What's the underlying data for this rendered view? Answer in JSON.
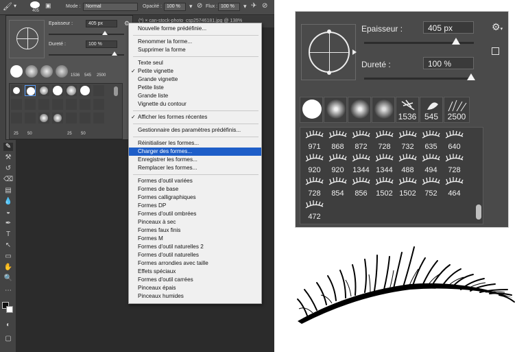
{
  "options_bar": {
    "brush_size": "405",
    "mode_label": "Mode :",
    "mode_value": "Normal",
    "opacity_label": "Opacité :",
    "opacity_value": "100 %",
    "flow_label": "Flux :",
    "flow_value": "100 %"
  },
  "document_tab": "(*) ×   can-stock-photo_csp25746181.jpg @ 138%",
  "small_brush_panel": {
    "size_label": "Epaisseur :",
    "size_value": "405 px",
    "hardness_label": "Dureté :",
    "hardness_value": "100 %",
    "tip_numbers": [
      "1536",
      "545",
      "2500"
    ],
    "grid_numbers": [
      "25",
      "50",
      "25",
      "50"
    ]
  },
  "menu": {
    "items": [
      {
        "label": "Nouvelle forme prédéfinie...",
        "checked": false,
        "highlighted": false
      },
      {
        "label": "Renommer la forme...",
        "checked": false,
        "highlighted": false
      },
      {
        "label": "Supprimer la forme",
        "checked": false,
        "highlighted": false
      },
      {
        "label": "Texte seul",
        "checked": false,
        "highlighted": false
      },
      {
        "label": "Petite vignette",
        "checked": true,
        "highlighted": false
      },
      {
        "label": "Grande vignette",
        "checked": false,
        "highlighted": false
      },
      {
        "label": "Petite liste",
        "checked": false,
        "highlighted": false
      },
      {
        "label": "Grande liste",
        "checked": false,
        "highlighted": false
      },
      {
        "label": "Vignette du contour",
        "checked": false,
        "highlighted": false
      },
      {
        "label": "Afficher les formes récentes",
        "checked": true,
        "highlighted": false
      },
      {
        "label": "Gestionnaire des paramètres prédéfinis...",
        "checked": false,
        "highlighted": false
      },
      {
        "label": "Réinitialiser les formes...",
        "checked": false,
        "highlighted": false
      },
      {
        "label": "Charger des formes...",
        "checked": false,
        "highlighted": true
      },
      {
        "label": "Enregistrer les formes...",
        "checked": false,
        "highlighted": false
      },
      {
        "label": "Remplacer les formes...",
        "checked": false,
        "highlighted": false
      },
      {
        "label": "Formes d'outil variées",
        "checked": false,
        "highlighted": false
      },
      {
        "label": "Formes de base",
        "checked": false,
        "highlighted": false
      },
      {
        "label": "Formes calligraphiques",
        "checked": false,
        "highlighted": false
      },
      {
        "label": "Formes DP",
        "checked": false,
        "highlighted": false
      },
      {
        "label": "Formes d'outil ombrées",
        "checked": false,
        "highlighted": false
      },
      {
        "label": "Pinceaux à sec",
        "checked": false,
        "highlighted": false
      },
      {
        "label": "Formes faux finis",
        "checked": false,
        "highlighted": false
      },
      {
        "label": "Formes M",
        "checked": false,
        "highlighted": false
      },
      {
        "label": "Formes d'outil naturelles 2",
        "checked": false,
        "highlighted": false
      },
      {
        "label": "Formes d'outil naturelles",
        "checked": false,
        "highlighted": false
      },
      {
        "label": "Formes arrondies avec taille",
        "checked": false,
        "highlighted": false
      },
      {
        "label": "Effets spéciaux",
        "checked": false,
        "highlighted": false
      },
      {
        "label": "Formes d'outil carrées",
        "checked": false,
        "highlighted": false
      },
      {
        "label": "Pinceaux épais",
        "checked": false,
        "highlighted": false
      },
      {
        "label": "Pinceaux humides",
        "checked": false,
        "highlighted": false
      }
    ]
  },
  "brush_panel": {
    "size_label": "Epaisseur :",
    "size_value": "405 px",
    "hardness_label": "Dureté :",
    "hardness_value": "100 %",
    "settings_icon": "gear-icon",
    "new_preset_icon": "new-preset-icon",
    "recent_tips": [
      "",
      "",
      "",
      "",
      "1536",
      "545",
      "2500"
    ],
    "lash_presets": [
      [
        "971",
        "868",
        "872",
        "728",
        "732",
        "635",
        "640"
      ],
      [
        "920",
        "920",
        "1344",
        "1344",
        "488",
        "494",
        "728"
      ],
      [
        "728",
        "854",
        "856",
        "1502",
        "1502",
        "752",
        "464"
      ],
      [
        "472"
      ]
    ]
  },
  "colors": {
    "menu_highlight": "#1e5ec8",
    "panel_bg": "#4a4a4a",
    "ps_bg": "#3c3c3c"
  }
}
